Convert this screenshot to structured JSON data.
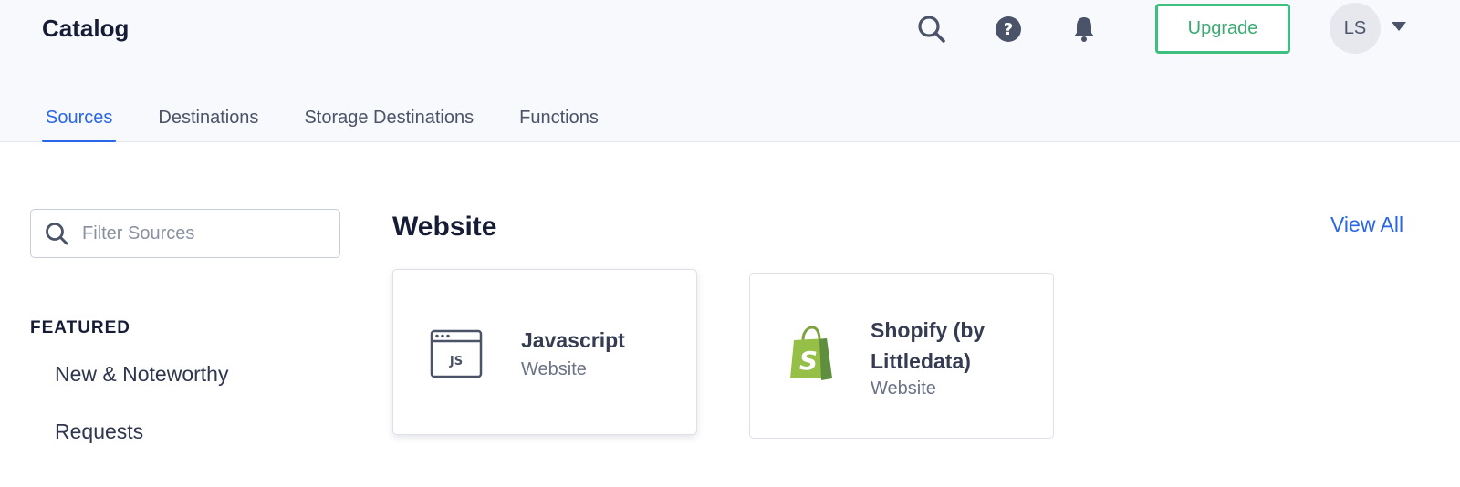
{
  "header": {
    "title": "Catalog",
    "upgrade_label": "Upgrade",
    "avatar_initials": "LS",
    "icons": [
      "search-icon",
      "help-icon",
      "bell-icon",
      "chevron-down-icon"
    ]
  },
  "tabs": [
    {
      "label": "Sources",
      "active": true
    },
    {
      "label": "Destinations",
      "active": false
    },
    {
      "label": "Storage Destinations",
      "active": false
    },
    {
      "label": "Functions",
      "active": false
    }
  ],
  "sidebar": {
    "search_placeholder": "Filter Sources",
    "search_value": "",
    "section_label": "FEATURED",
    "items": [
      {
        "label": "New & Noteworthy"
      },
      {
        "label": "Requests"
      }
    ]
  },
  "main": {
    "section_title": "Website",
    "view_all_label": "View All",
    "cards": [
      {
        "name": "Javascript",
        "category": "Website",
        "icon": "js-browser-icon"
      },
      {
        "name_line1": "Shopify (by",
        "name_line2": "Littledata)",
        "category": "Website",
        "icon": "shopify-bag-icon"
      }
    ]
  },
  "colors": {
    "accent": "#2966e8",
    "upgrade": "#3fbf7f",
    "shopify_green": "#95bf47",
    "header_bg": "#f8f9fd"
  }
}
